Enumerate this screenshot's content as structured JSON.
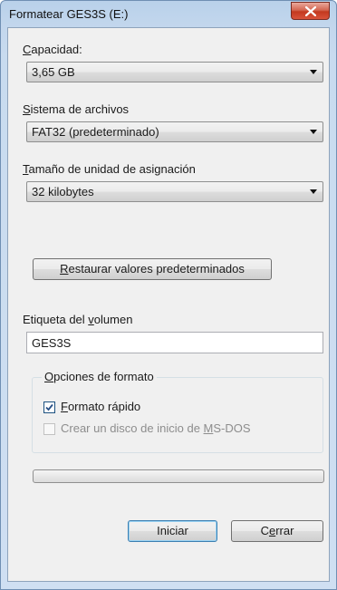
{
  "window": {
    "title": "Formatear GES3S (E:)"
  },
  "capacity": {
    "label_first": "C",
    "label_rest": "apacidad:",
    "value": "3,65 GB"
  },
  "filesystem": {
    "label_first": "S",
    "label_rest": "istema de archivos",
    "value": "FAT32 (predeterminado)"
  },
  "allocation": {
    "label_first": "T",
    "label_rest": "amaño de unidad de asignación",
    "value": "32 kilobytes"
  },
  "restore_button": {
    "label_first": "R",
    "label_rest": "estaurar valores predeterminados"
  },
  "volume": {
    "label_before": "Etiqueta del ",
    "label_accel": "v",
    "label_after": "olumen",
    "value": "GES3S"
  },
  "format_options": {
    "title_first": "O",
    "title_rest": "pciones de formato",
    "quick_format": {
      "label_first": "F",
      "label_rest": "ormato rápido",
      "checked": true
    },
    "msdos_disk": {
      "label_before": "Crear un disco de inicio de ",
      "label_accel": "M",
      "label_after": "S-DOS",
      "checked": false,
      "disabled": true
    }
  },
  "progress": {
    "value_percent": 0
  },
  "buttons": {
    "start": "Iniciar",
    "close_before": "C",
    "close_accel": "e",
    "close_after": "rrar"
  },
  "colors": {
    "title_gradient_top": "#b9d1ea",
    "close_button_red": "#c3391f",
    "dialog_background": "#f0f0f0"
  }
}
